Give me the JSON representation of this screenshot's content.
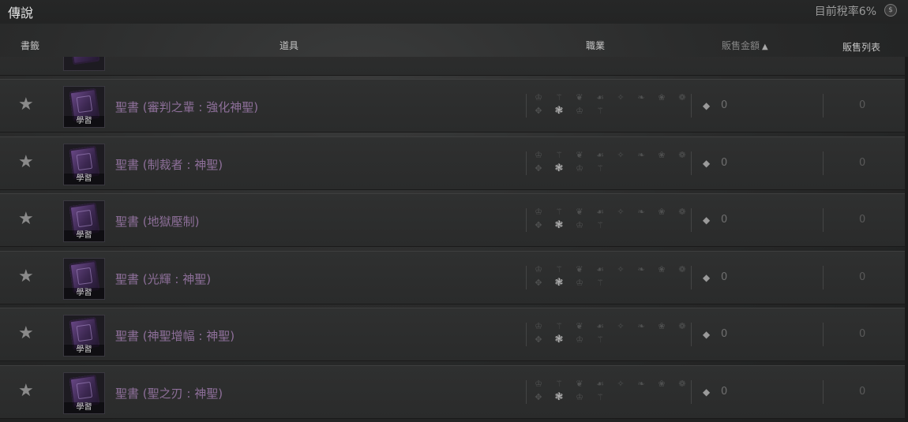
{
  "header_bar": {
    "category": "傳說",
    "tax_label": "目前稅率6%",
    "tax_icon_glyph": "$"
  },
  "columns": {
    "bookmark": "書籤",
    "item": "道具",
    "class": "職業",
    "price": "販售金額",
    "price_sort_glyph": "▲",
    "listings": "販售列表"
  },
  "class_glyphs": [
    "♔",
    "⚚",
    "❦",
    "☙",
    "✧",
    "❧",
    "❀",
    "❁",
    "✥",
    "❃"
  ],
  "items": [
    {
      "name": "聖書 (審判之輩 : 強化神聖)",
      "tag": "學習",
      "price": "0",
      "listings": "0",
      "active_class": 1
    },
    {
      "name": "聖書 (制裁者 : 神聖)",
      "tag": "學習",
      "price": "0",
      "listings": "0",
      "active_class": 1
    },
    {
      "name": "聖書 (地獄壓制)",
      "tag": "學習",
      "price": "0",
      "listings": "0",
      "active_class": 1
    },
    {
      "name": "聖書 (光輝 : 神聖)",
      "tag": "學習",
      "price": "0",
      "listings": "0",
      "active_class": 1
    },
    {
      "name": "聖書 (神聖增幅 : 神聖)",
      "tag": "學習",
      "price": "0",
      "listings": "0",
      "active_class": 1
    },
    {
      "name": "聖書 (聖之刃 : 神聖)",
      "tag": "學習",
      "price": "0",
      "listings": "0",
      "active_class": 1
    }
  ],
  "icons": {
    "bookmark": "star-icon",
    "price": "gem-icon",
    "item": "holy-book-icon"
  },
  "colors": {
    "item_name": "#8d6f99",
    "background": "#2a2b2b"
  }
}
